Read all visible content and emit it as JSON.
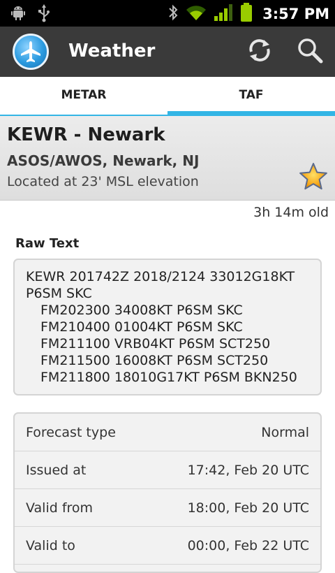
{
  "status_bar": {
    "time": "3:57 PM",
    "left_icons": [
      "android-debug-icon",
      "usb-icon"
    ],
    "right_icons": [
      "bluetooth-icon",
      "wifi-icon",
      "signal-icon",
      "battery-icon"
    ]
  },
  "action_bar": {
    "title": "Weather",
    "icons": [
      "airplane-logo-icon",
      "refresh-icon",
      "search-icon"
    ]
  },
  "tabs": [
    {
      "label": "METAR",
      "selected": false
    },
    {
      "label": "TAF",
      "selected": true
    }
  ],
  "station": {
    "id_name": "KEWR - Newark",
    "type_location": "ASOS/AWOS, Newark, NJ",
    "elevation": "Located at 23' MSL elevation",
    "favorite_icon": "star-icon"
  },
  "age": "3h 14m old",
  "raw": {
    "label": "Raw Text",
    "lines": [
      "KEWR 201742Z 2018/2124 33012G18KT",
      "P6SM SKC",
      "FM202300 34008KT P6SM SKC",
      "FM210400 01004KT P6SM SKC",
      "FM211100 VRB04KT P6SM SCT250",
      "FM211500 16008KT P6SM SCT250",
      "FM211800 18010G17KT P6SM BKN250"
    ]
  },
  "details": [
    {
      "label": "Forecast type",
      "value": "Normal"
    },
    {
      "label": "Issued at",
      "value": "17:42, Feb 20 UTC"
    },
    {
      "label": "Valid from",
      "value": "18:00, Feb 20 UTC"
    },
    {
      "label": "Valid to",
      "value": "00:00, Feb 22 UTC"
    }
  ],
  "colors": {
    "accent": "#33b5e5",
    "action_bar": "#3a3a3a",
    "status_bar": "#000000",
    "battery": "#99cc00"
  }
}
